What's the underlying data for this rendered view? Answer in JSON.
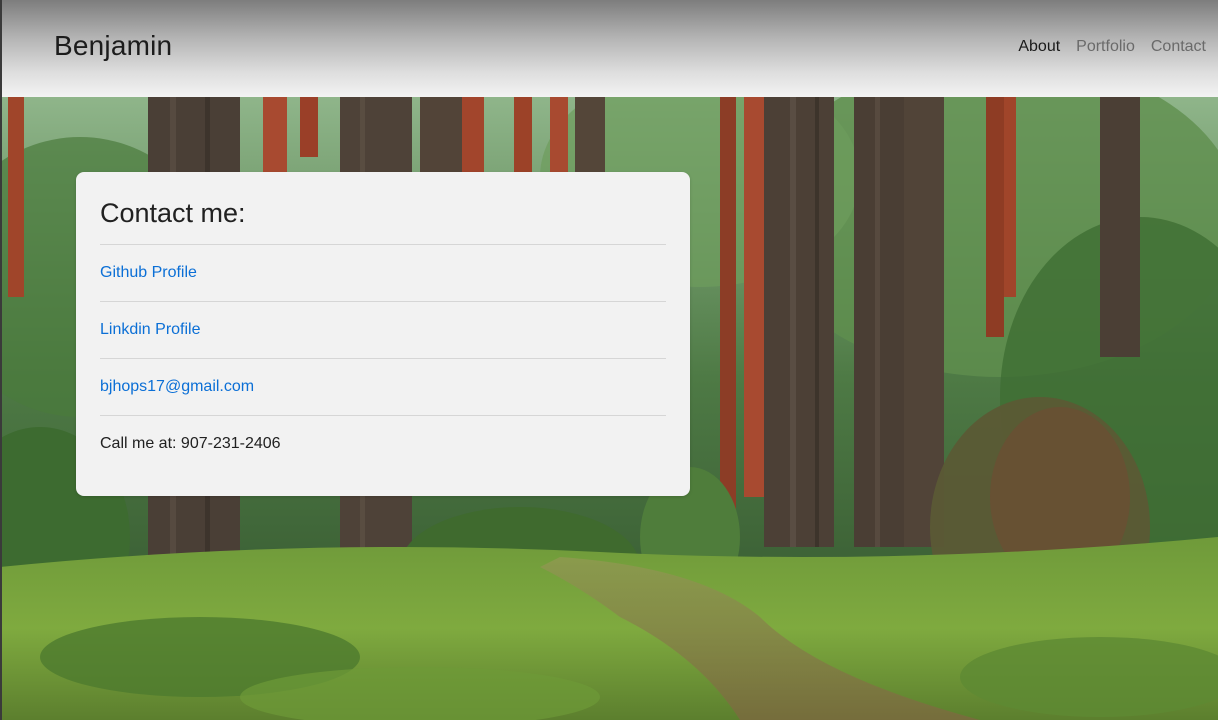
{
  "navbar": {
    "brand": "Benjamin",
    "links": [
      {
        "label": "About",
        "active": true
      },
      {
        "label": "Portfolio",
        "active": false
      },
      {
        "label": "Contact",
        "active": false
      }
    ]
  },
  "contact_card": {
    "title": "Contact me:",
    "github_link": "Github Profile",
    "linkedin_link": "Linkdin Profile",
    "email_link": "bjhops17@gmail.com",
    "phone_text": "Call me at: 907-231-2406"
  },
  "colors": {
    "link": "#0b6fd6",
    "card_bg": "#f2f2f2",
    "text": "#212121"
  },
  "background": {
    "icon": "forest-photo"
  }
}
